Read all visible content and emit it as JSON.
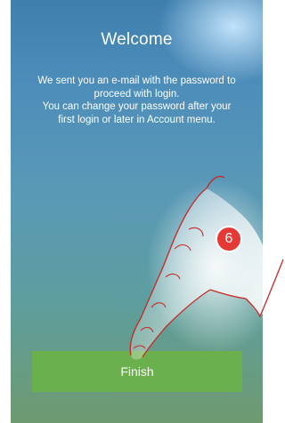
{
  "welcome": {
    "title": "Welcome",
    "line1": "We sent you an e-mail with the password to",
    "line2": "proceed with login.",
    "line3": "You can change your password after your",
    "line4": "first login or later in Account menu."
  },
  "actions": {
    "finish_label": "Finish"
  },
  "annotation": {
    "step_number": "6"
  },
  "colors": {
    "button": "#6ab04c",
    "badge": "#e53935",
    "text": "#ffffff"
  }
}
